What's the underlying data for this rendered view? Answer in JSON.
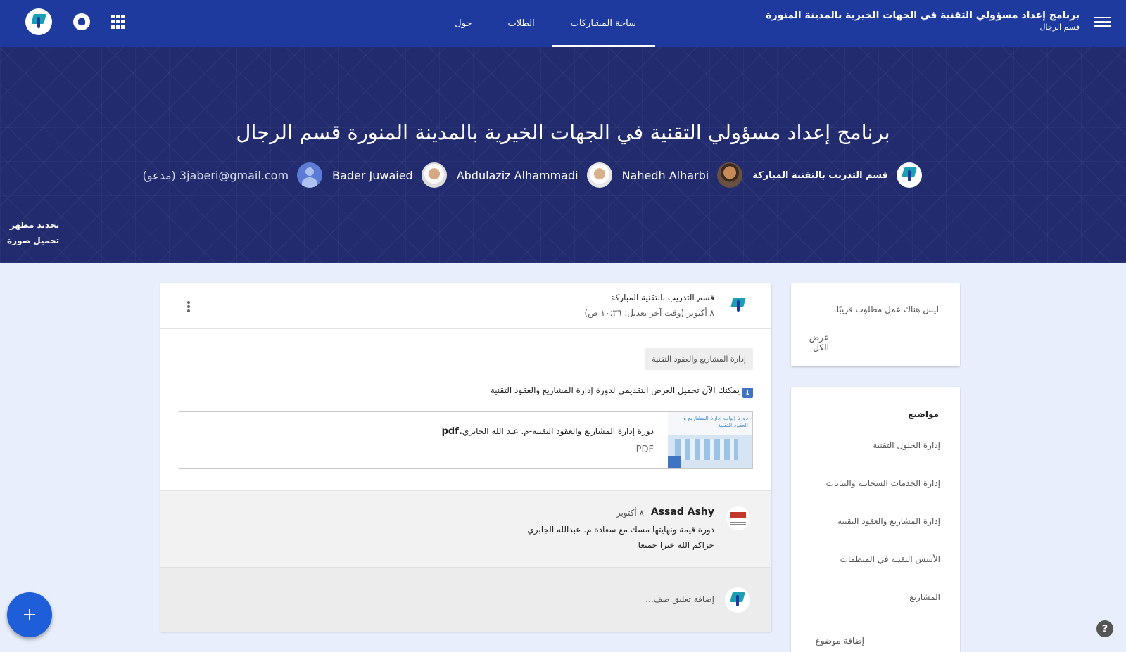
{
  "header": {
    "course_title": "برنامج إعداد مسؤولي التقنية في الجهات الخيرية بالمدينة المنورة",
    "course_section": "قسم الرجال",
    "tabs": [
      {
        "label": "ساحة المشاركات",
        "active": true
      },
      {
        "label": "الطلاب",
        "active": false
      },
      {
        "label": "حول",
        "active": false
      }
    ],
    "icons": [
      "menu-icon",
      "apps-grid-icon",
      "notifications-bell-icon",
      "account-logo"
    ]
  },
  "banner": {
    "title": "برنامج إعداد مسؤولي التقنية في الجهات الخيرية بالمدينة المنورة قسم الرجال",
    "teachers": [
      {
        "name": "قسم التدريب بالتقنية المباركة"
      },
      {
        "name": "Nahedh Alharbi"
      },
      {
        "name": "Abdulaziz Alhammadi"
      },
      {
        "name": "Bader Juwaied"
      },
      {
        "name": "3jaberi@gmail.com (مدعو)"
      }
    ],
    "actions": {
      "select_theme": "تحديد مظهر",
      "upload_photo": "تحميل صورة"
    }
  },
  "post": {
    "author": "قسم التدريب بالتقنية المباركة",
    "date": "٨ أكتوبر (وقت آخر تعديل: ١٠:٣٦ ص)",
    "topic": "إدارة المشاريع والعقود التقنية",
    "text": "يمكنك الآن تحميل العرض التقديمي لدورة إدارة المشاريع والعقود التقنية",
    "attachment": {
      "name_prefix": "دورة إدارة المشاريع والعقود التقنية-م. عبد الله الجابري",
      "name_ext": ".pdf",
      "type": "PDF",
      "thumb_text": "دورة إليات إدارة المشاريع و العقود التقنية"
    },
    "comment": {
      "author": "Assad Ashy",
      "date": "٨ أكتوبر",
      "line1": "دورة قيمة ونهايتها مسك مع سعادة م. عبدالله الجابري",
      "line2": "جزاكم الله خيرا جميعا"
    },
    "add_comment_placeholder": "إضافة تعليق صف..."
  },
  "upcoming": {
    "empty": "ليس هناك عمل مطلوب قريبًا.",
    "view_all": "عرض الكل"
  },
  "topics": {
    "heading": "مواضيع",
    "items": [
      "إدارة الحلول التقنية",
      "إدارة الخدمات السحابية والبيانات",
      "إدارة المشاريع والعقود التقنية",
      "الأسس التقنية في المنظمات",
      "المشاريع"
    ],
    "add_topic": "إضافة موضوع"
  },
  "help_glyph": "?"
}
